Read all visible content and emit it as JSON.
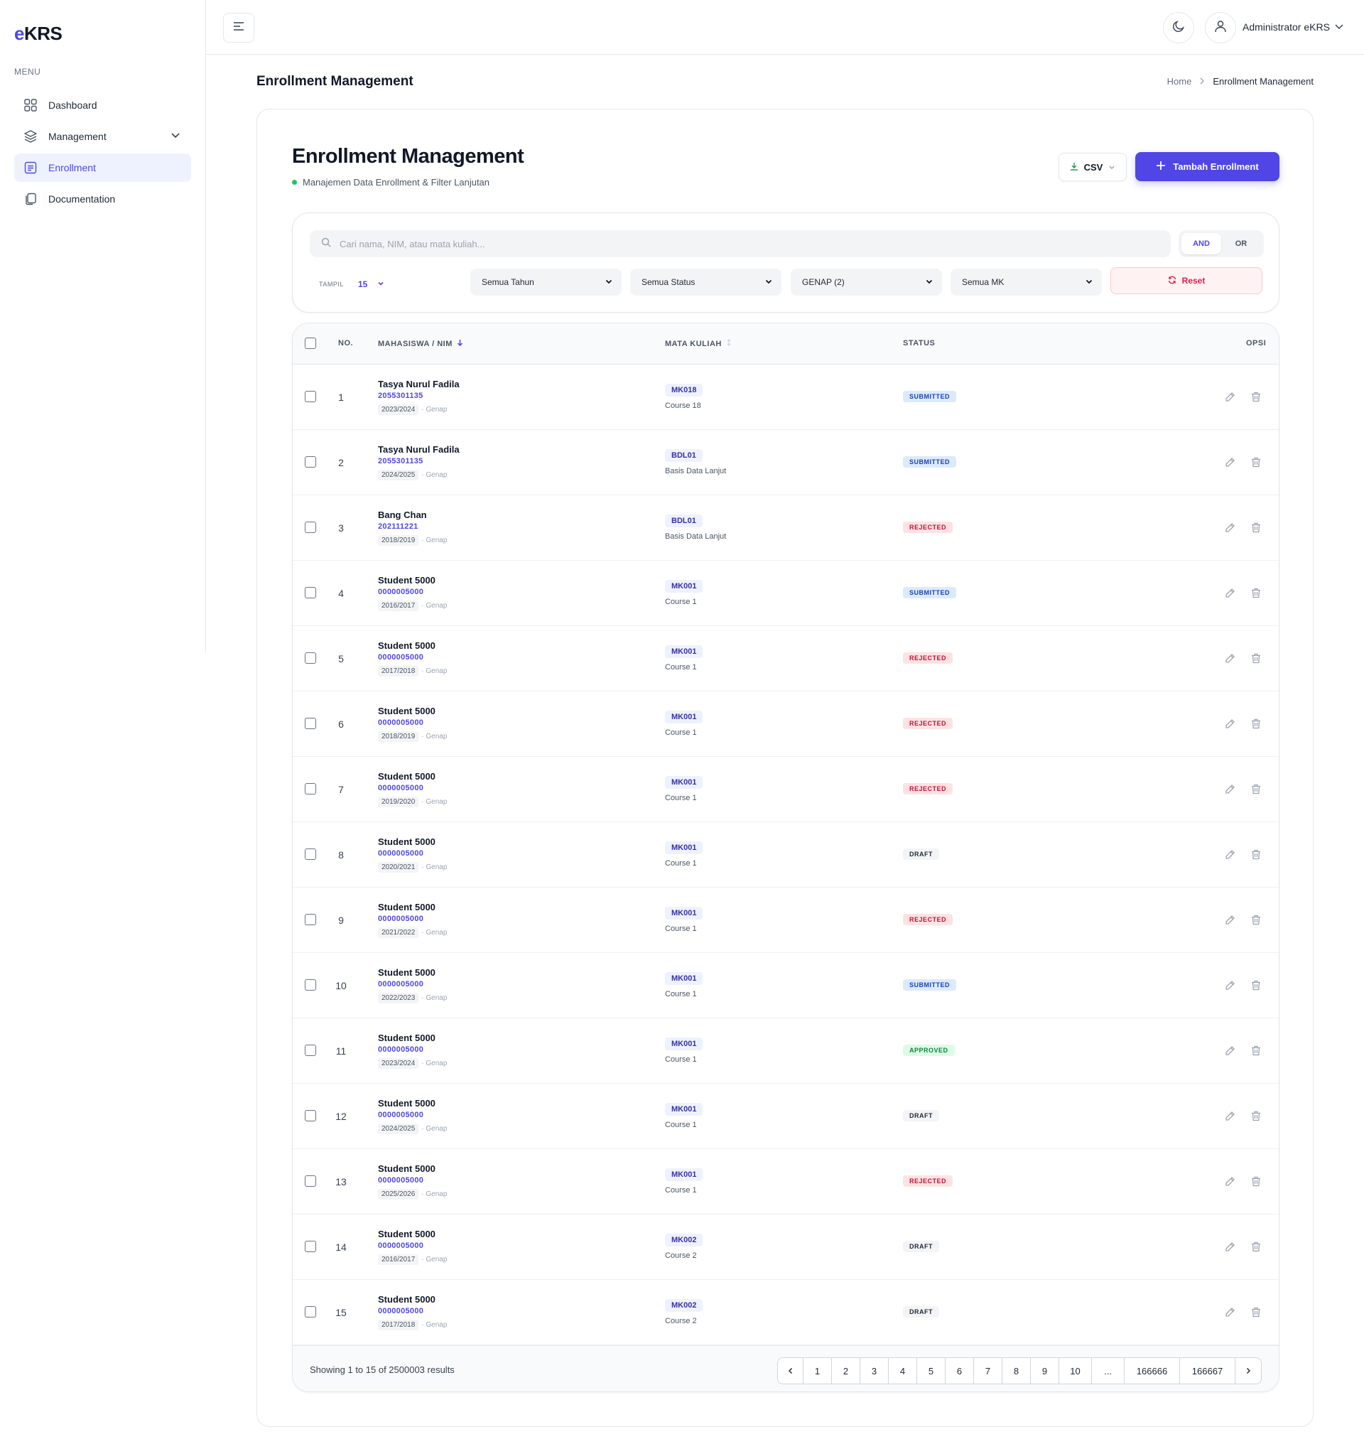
{
  "app": {
    "logo_prefix": "e",
    "logo_rest": "KRS"
  },
  "sidebar": {
    "menu_label": "MENU",
    "items": [
      {
        "label": "Dashboard",
        "icon": "dashboard-grid-icon"
      },
      {
        "label": "Management",
        "icon": "layers-icon"
      },
      {
        "label": "Enrollment",
        "icon": "list-document-icon",
        "active": true
      },
      {
        "label": "Documentation",
        "icon": "copy-document-icon"
      }
    ]
  },
  "topbar": {
    "user_name": "Administrator eKRS"
  },
  "page": {
    "title": "Enrollment Management",
    "breadcrumb": {
      "home": "Home",
      "current": "Enrollment Management"
    }
  },
  "card": {
    "title": "Enrollment Management",
    "subtitle": "Manajemen Data Enrollment & Filter Lanjutan",
    "csv_label": "CSV",
    "add_label": "Tambah Enrollment"
  },
  "filters": {
    "search_placeholder": "Cari nama, NIM, atau mata kuliah...",
    "logic_and": "AND",
    "logic_or": "OR",
    "tampil_label": "TAMPIL",
    "tampil_value": "15",
    "tahun": "Semua Tahun",
    "status": "Semua Status",
    "semester": "GENAP (2)",
    "mk": "Semua MK",
    "reset_label": "Reset"
  },
  "table": {
    "headers": {
      "no": "NO.",
      "mahasiswa": "MAHASISWA / NIM",
      "matkul": "MATA KULIAH",
      "status": "STATUS",
      "opsi": "OPSI"
    },
    "rows": [
      {
        "no": "1",
        "name": "Tasya Nurul Fadila",
        "nim": "2055301135",
        "year": "2023/2024",
        "sem": "· Genap",
        "code": "MK018",
        "course": "Course 18",
        "status": "SUBMITTED"
      },
      {
        "no": "2",
        "name": "Tasya Nurul Fadila",
        "nim": "2055301135",
        "year": "2024/2025",
        "sem": "· Genap",
        "code": "BDL01",
        "course": "Basis Data Lanjut",
        "status": "SUBMITTED"
      },
      {
        "no": "3",
        "name": "Bang Chan",
        "nim": "202111221",
        "year": "2018/2019",
        "sem": "· Genap",
        "code": "BDL01",
        "course": "Basis Data Lanjut",
        "status": "REJECTED"
      },
      {
        "no": "4",
        "name": "Student 5000",
        "nim": "0000005000",
        "year": "2016/2017",
        "sem": "· Genap",
        "code": "MK001",
        "course": "Course 1",
        "status": "SUBMITTED"
      },
      {
        "no": "5",
        "name": "Student 5000",
        "nim": "0000005000",
        "year": "2017/2018",
        "sem": "· Genap",
        "code": "MK001",
        "course": "Course 1",
        "status": "REJECTED"
      },
      {
        "no": "6",
        "name": "Student 5000",
        "nim": "0000005000",
        "year": "2018/2019",
        "sem": "· Genap",
        "code": "MK001",
        "course": "Course 1",
        "status": "REJECTED"
      },
      {
        "no": "7",
        "name": "Student 5000",
        "nim": "0000005000",
        "year": "2019/2020",
        "sem": "· Genap",
        "code": "MK001",
        "course": "Course 1",
        "status": "REJECTED"
      },
      {
        "no": "8",
        "name": "Student 5000",
        "nim": "0000005000",
        "year": "2020/2021",
        "sem": "· Genap",
        "code": "MK001",
        "course": "Course 1",
        "status": "DRAFT"
      },
      {
        "no": "9",
        "name": "Student 5000",
        "nim": "0000005000",
        "year": "2021/2022",
        "sem": "· Genap",
        "code": "MK001",
        "course": "Course 1",
        "status": "REJECTED"
      },
      {
        "no": "10",
        "name": "Student 5000",
        "nim": "0000005000",
        "year": "2022/2023",
        "sem": "· Genap",
        "code": "MK001",
        "course": "Course 1",
        "status": "SUBMITTED"
      },
      {
        "no": "11",
        "name": "Student 5000",
        "nim": "0000005000",
        "year": "2023/2024",
        "sem": "· Genap",
        "code": "MK001",
        "course": "Course 1",
        "status": "APPROVED"
      },
      {
        "no": "12",
        "name": "Student 5000",
        "nim": "0000005000",
        "year": "2024/2025",
        "sem": "· Genap",
        "code": "MK001",
        "course": "Course 1",
        "status": "DRAFT"
      },
      {
        "no": "13",
        "name": "Student 5000",
        "nim": "0000005000",
        "year": "2025/2026",
        "sem": "· Genap",
        "code": "MK001",
        "course": "Course 1",
        "status": "REJECTED"
      },
      {
        "no": "14",
        "name": "Student 5000",
        "nim": "0000005000",
        "year": "2016/2017",
        "sem": "· Genap",
        "code": "MK002",
        "course": "Course 2",
        "status": "DRAFT"
      },
      {
        "no": "15",
        "name": "Student 5000",
        "nim": "0000005000",
        "year": "2017/2018",
        "sem": "· Genap",
        "code": "MK002",
        "course": "Course 2",
        "status": "DRAFT"
      }
    ],
    "footer": {
      "showing": "Showing 1 to 15 of 2500003 results",
      "pages": [
        "1",
        "2",
        "3",
        "4",
        "5",
        "6",
        "7",
        "8",
        "9",
        "10",
        "...",
        "166666",
        "166667"
      ]
    }
  },
  "colors": {
    "accent": "#4f46e5",
    "danger": "#e11d48",
    "success": "#22c55e"
  }
}
